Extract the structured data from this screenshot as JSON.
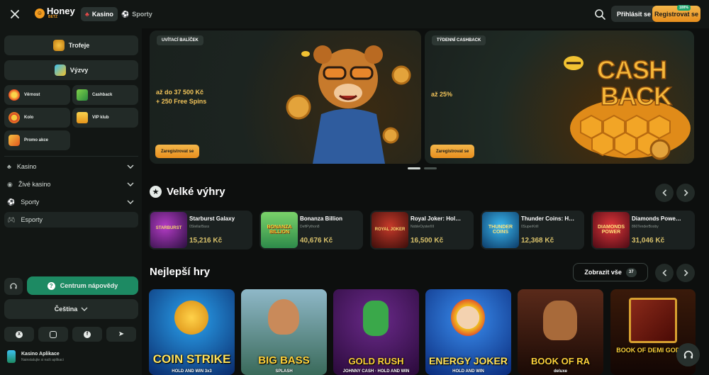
{
  "header": {
    "logo_name": "Honey",
    "logo_sub": "BETZ",
    "tabs": [
      {
        "label": "Kasino",
        "icon": "cherry-icon",
        "active": true
      },
      {
        "label": "Sporty",
        "icon": "ball-icon",
        "active": false
      }
    ],
    "login_label": "Přihlásit se",
    "register_label": "Registrovat se",
    "register_badge": "100%"
  },
  "sidebar": {
    "trophies": "Trofeje",
    "challenges": "Výzvy",
    "tiles": [
      {
        "label": "Věrnost",
        "icon": "loyalty-icon"
      },
      {
        "label": "Cashback",
        "icon": "cashback-icon"
      },
      {
        "label": "Kolo",
        "icon": "wheel-icon"
      },
      {
        "label": "VIP klub",
        "icon": "crown-icon"
      },
      {
        "label": "Promo akce",
        "icon": "promo-icon"
      }
    ],
    "sections": [
      {
        "label": "Kasino",
        "icon": "cherry-icon"
      },
      {
        "label": "Živé kasino",
        "icon": "live-icon"
      },
      {
        "label": "Sporty",
        "icon": "ball-icon"
      },
      {
        "label": "Esporty",
        "icon": "gamepad-icon"
      }
    ],
    "help_label": "Centrum nápovědy",
    "language": "Čeština",
    "app_title": "Kasino Aplikace",
    "app_subtitle": "Nainstalujte si naši aplikaci"
  },
  "promos": [
    {
      "badge": "UVÍTACÍ BALÍČEK",
      "amount": "až do 37 500 Kč",
      "extra": "+ 250 Free Spins",
      "button": "Zaregistrovat se"
    },
    {
      "badge": "TÝDENNÍ CASHBACK",
      "amount": "až 25%",
      "extra": "",
      "button": "Zaregistrovat se",
      "art_text_1": "CASH",
      "art_text_2": "BACK"
    }
  ],
  "big_wins": {
    "title": "Velké výhry",
    "items": [
      {
        "game": "Starburst Galaxy",
        "user": "0StellarBass",
        "amount": "15,216 Kč",
        "thumb": "STARBURST"
      },
      {
        "game": "Bonanza Billion",
        "user": "DeftPython8",
        "amount": "40,676 Kč",
        "thumb": "BONANZA BILLION"
      },
      {
        "game": "Royal Joker: Hol…",
        "user": "NobleOysterIIII",
        "amount": "16,500 Kč",
        "thumb": "ROYAL JOKER"
      },
      {
        "game": "Thunder Coins: H…",
        "user": "0SuperKrill",
        "amount": "12,368 Kč",
        "thumb": "THUNDER COINS"
      },
      {
        "game": "Diamonds Powe…",
        "user": "860TenderBooby",
        "amount": "31,046 Kč",
        "thumb": "DIAMONDS POWER"
      }
    ]
  },
  "top_games": {
    "title": "Nejlepší hry",
    "show_all": "Zobrazit vše",
    "count": "37",
    "items": [
      {
        "title": "COIN STRIKE",
        "sub": "HOLD AND WIN 3x3"
      },
      {
        "title": "BIG BASS",
        "sub": "SPLASH"
      },
      {
        "title": "GOLD RUSH",
        "sub": "JOHNNY CASH · HOLD AND WIN"
      },
      {
        "title": "ENERGY JOKER",
        "sub": "HOLD AND WIN"
      },
      {
        "title": "BOOK OF RA",
        "sub": "deluxe"
      },
      {
        "title": "BOOK OF DEMI GODS II",
        "sub": ""
      }
    ]
  }
}
